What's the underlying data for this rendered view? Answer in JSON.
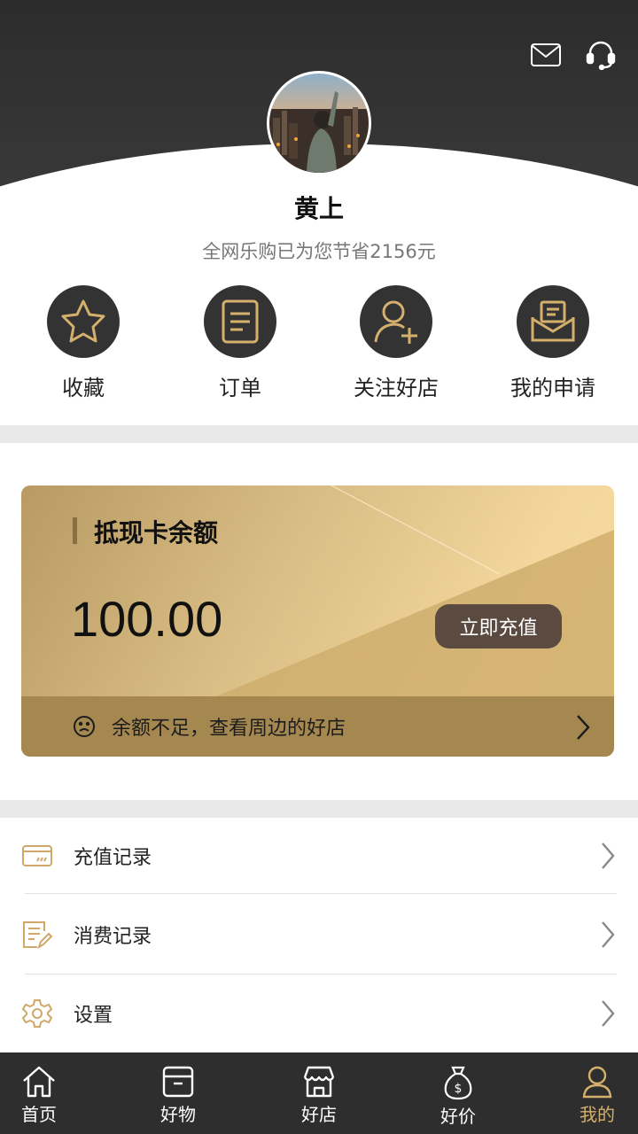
{
  "header": {
    "user_name": "黄上",
    "saved_text": "全网乐购已为您节省2156元",
    "icons": [
      "mail-icon",
      "headset-icon"
    ]
  },
  "quick_actions": [
    {
      "label": "收藏",
      "icon": "star-icon"
    },
    {
      "label": "订单",
      "icon": "order-list-icon"
    },
    {
      "label": "关注好店",
      "icon": "follow-user-icon"
    },
    {
      "label": "我的申请",
      "icon": "envelope-document-icon"
    }
  ],
  "card": {
    "title": "抵现卡余额",
    "amount": "100.00",
    "recharge_label": "立即充值",
    "footer_text": "余额不足，查看周边的好店",
    "colors": {
      "gold_light": "#f6dba1",
      "gold_dark": "#a58750",
      "button": "#5b4a3f"
    }
  },
  "menu": [
    {
      "label": "充值记录",
      "icon": "card-icon"
    },
    {
      "label": "消费记录",
      "icon": "bill-edit-icon"
    },
    {
      "label": "设置",
      "icon": "gear-icon"
    }
  ],
  "bottom_nav": [
    {
      "label": "首页",
      "icon": "home-icon"
    },
    {
      "label": "好物",
      "icon": "box-icon"
    },
    {
      "label": "好店",
      "icon": "store-icon"
    },
    {
      "label": "好价",
      "icon": "money-bag-icon"
    },
    {
      "label": "我的",
      "icon": "user-icon",
      "active": true
    }
  ],
  "accent_color": "#d4b06c"
}
